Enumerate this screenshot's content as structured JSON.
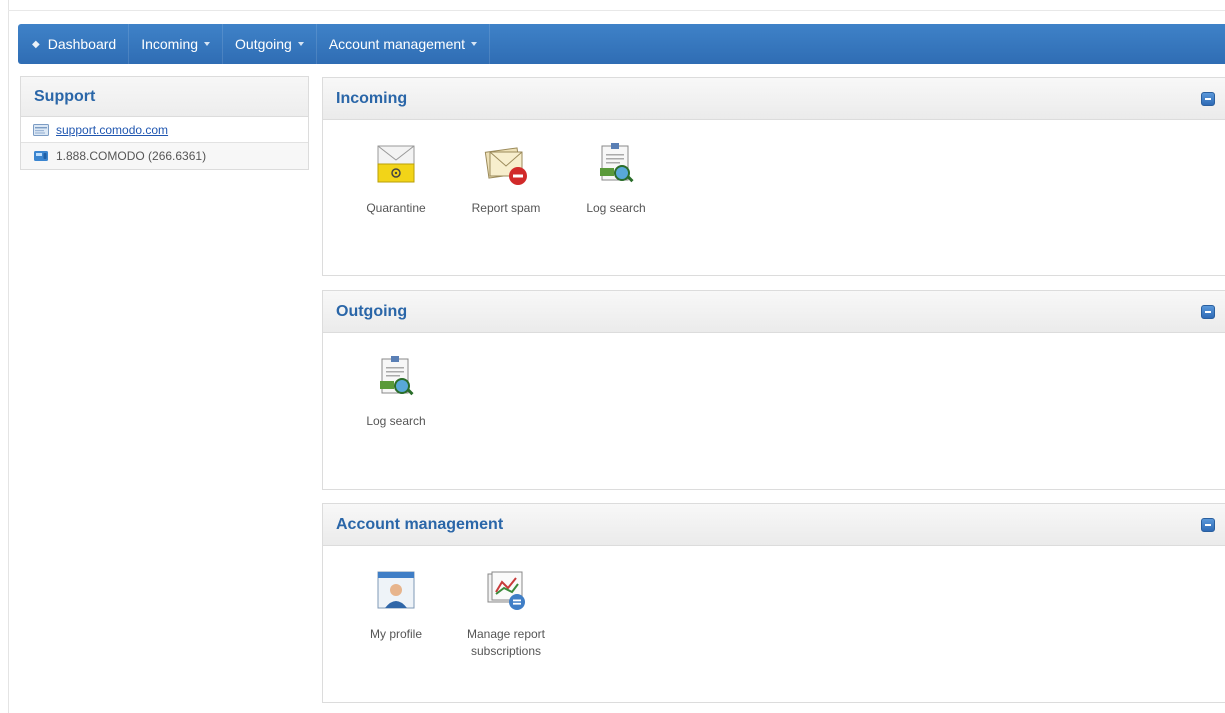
{
  "nav": {
    "items": [
      {
        "label": "Dashboard",
        "icon": "home-icon"
      },
      {
        "label": "Incoming",
        "icon": "chevron-down-icon"
      },
      {
        "label": "Outgoing",
        "icon": "chevron-down-icon"
      },
      {
        "label": "Account management",
        "icon": "chevron-down-icon"
      }
    ],
    "accent_color": "#3676be"
  },
  "support": {
    "title": "Support",
    "link": "support.comodo.com",
    "phone": "1.888.COMODO (266.6361)"
  },
  "panels": {
    "incoming": {
      "title": "Incoming",
      "tiles": [
        {
          "label": "Quarantine",
          "icon": "quarantine-icon"
        },
        {
          "label": "Report spam",
          "icon": "report-spam-icon"
        },
        {
          "label": "Log search",
          "icon": "log-search-icon"
        }
      ]
    },
    "outgoing": {
      "title": "Outgoing",
      "tiles": [
        {
          "label": "Log search",
          "icon": "log-search-icon"
        }
      ]
    },
    "account": {
      "title": "Account management",
      "tiles": [
        {
          "label": "My profile",
          "icon": "profile-icon"
        },
        {
          "label": "Manage report subscriptions",
          "icon": "subscriptions-icon"
        }
      ]
    }
  }
}
